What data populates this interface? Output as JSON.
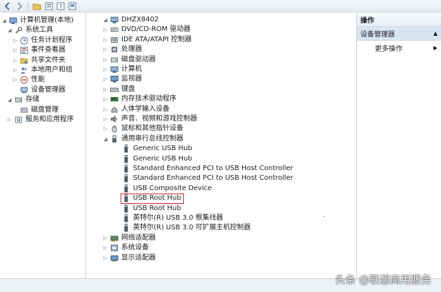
{
  "left_tree": {
    "items": [
      {
        "label": "计算机管理(本地)",
        "icon": "computer-manage-icon",
        "expander": "collapse"
      },
      {
        "label": "系统工具",
        "icon": "tools-icon",
        "expander": "collapse"
      },
      {
        "label": "任务计划程序",
        "icon": "clock-icon",
        "expander": "expand"
      },
      {
        "label": "事件查看器",
        "icon": "event-viewer-icon",
        "expander": "expand"
      },
      {
        "label": "共享文件夹",
        "icon": "shared-folder-icon",
        "expander": "expand"
      },
      {
        "label": "本地用户和组",
        "icon": "users-icon",
        "expander": "expand"
      },
      {
        "label": "性能",
        "icon": "performance-icon",
        "expander": "expand"
      },
      {
        "label": "设备管理器",
        "icon": "device-manager-icon",
        "expander": "none"
      },
      {
        "label": "存储",
        "icon": "storage-icon",
        "expander": "collapse"
      },
      {
        "label": "磁盘管理",
        "icon": "disk-icon",
        "expander": "none"
      },
      {
        "label": "服务和应用程序",
        "icon": "services-icon",
        "expander": "expand"
      }
    ]
  },
  "device_tree": {
    "root": "DHZX8402",
    "categories": [
      "DVD/CD-ROM 驱动器",
      "IDE ATA/ATAPI 控制器",
      "处理器",
      "磁盘驱动器",
      "计算机",
      "监视器",
      "键盘",
      "内存技术驱动程序",
      "人体学输入设备",
      "声音、视频和游戏控制器",
      "鼠标和其他指针设备",
      "通用串行总线控制器"
    ],
    "usb_children": [
      "Generic USB Hub",
      "Generic USB Hub",
      "Standard Enhanced PCI to USB Host Controller",
      "Standard Enhanced PCI to USB Host Controller",
      "USB Composite Device",
      "USB Root Hub",
      "USB Root Hub",
      "英特尔(R) USB 3.0 根集线器",
      "英特尔(R) USB 3.0 可扩展主机控制器"
    ],
    "trailing_categories": [
      "网络适配器",
      "系统设备",
      "显示适配器"
    ]
  },
  "actions": {
    "header": "操作",
    "section": "设备管理器",
    "more": "更多操作"
  },
  "watermark": "头条 @联想商用服务",
  "colors": {
    "selection_border": "#d9282a",
    "section_bg": "#d8e6f3"
  }
}
